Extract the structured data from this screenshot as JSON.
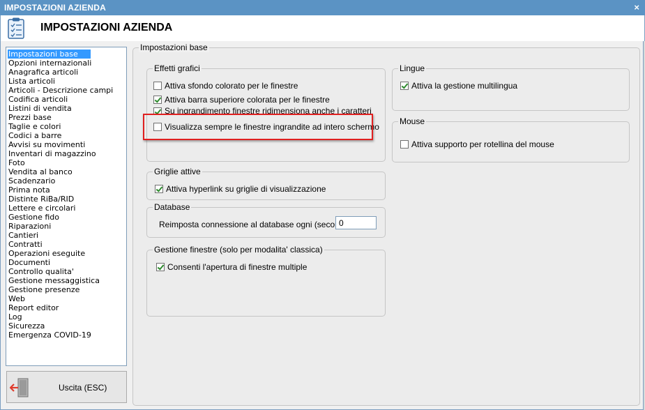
{
  "window": {
    "title": "IMPOSTAZIONI AZIENDA",
    "close_glyph": "×"
  },
  "header": {
    "title": "IMPOSTAZIONI AZIENDA",
    "icon": "clipboard-checklist-icon"
  },
  "sidebar": {
    "selected": "Impostazioni base",
    "items": [
      "Impostazioni base",
      "Opzioni internazionali",
      "Anagrafica articoli",
      "Lista articoli",
      "Articoli - Descrizione campi",
      "Codifica articoli",
      "Listini di vendita",
      "Prezzi base",
      "Taglie e colori",
      "Codici a barre",
      "Avvisi su movimenti",
      "Inventari di magazzino",
      "Foto",
      "Vendita al banco",
      "Scadenzario",
      "Prima nota",
      "Distinte RiBa/RID",
      "Lettere e circolari",
      "Gestione fido",
      "Riparazioni",
      "Cantieri",
      "Contratti",
      "Operazioni eseguite",
      "Documenti",
      "Controllo qualita'",
      "Gestione messaggistica",
      "Gestione presenze",
      "Web",
      "Report editor",
      "Log",
      "Sicurezza",
      "Emergenza COVID-19"
    ]
  },
  "exit_button": {
    "label": "Uscita (ESC)",
    "icon": "exit-door-arrow-icon"
  },
  "main": {
    "title": "Impostazioni base",
    "effetti_grafici": {
      "title": "Effetti grafici",
      "options": [
        {
          "label": "Attiva sfondo colorato per le finestre",
          "checked": false
        },
        {
          "label": "Attiva barra superiore colorata per le finestre",
          "checked": true
        },
        {
          "label": "Su ingrandimento finestre ridimensiona anche i caratteri",
          "checked": true
        },
        {
          "label": "Visualizza sempre le finestre ingrandite ad intero schermo",
          "checked": false
        }
      ]
    },
    "griglie": {
      "title": "Griglie attive",
      "options": [
        {
          "label": "Attiva hyperlink su griglie di visualizzazione",
          "checked": true
        }
      ]
    },
    "database": {
      "title": "Database",
      "reconnect_label": "Reimposta connessione al database ogni (secondi) :",
      "reconnect_value": "0"
    },
    "gestione_finestre": {
      "title": "Gestione finestre (solo per modalita' classica)",
      "options": [
        {
          "label": "Consenti l'apertura di finestre multiple",
          "checked": true
        }
      ]
    },
    "lingue": {
      "title": "Lingue",
      "options": [
        {
          "label": "Attiva la gestione multilingua",
          "checked": true
        }
      ]
    },
    "mouse": {
      "title": "Mouse",
      "options": [
        {
          "label": "Attiva supporto per rotellina del mouse",
          "checked": false
        }
      ]
    }
  },
  "colors": {
    "titlebar": "#5b93c4",
    "selection": "#3399ff",
    "highlight_frame": "#e02020",
    "check": "#2e8b2e"
  }
}
